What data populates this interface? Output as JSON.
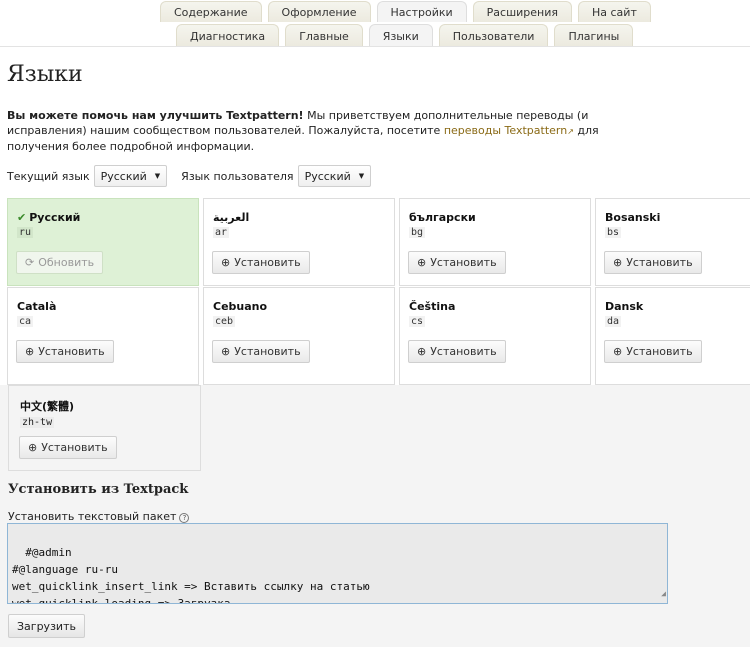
{
  "nav_primary": [
    "Содержание",
    "Оформление",
    "Настройки",
    "Расширения",
    "На сайт"
  ],
  "nav_secondary": [
    "Диагностика",
    "Главные",
    "Языки",
    "Пользователи",
    "Плагины"
  ],
  "page_title": "Языки",
  "intro": {
    "bold": "Вы можете помочь нам улучшить Textpattern!",
    "text1": " Мы приветствуем дополнительные переводы (и исправления) нашим сообществом пользователей. Пожалуйста, посетите ",
    "link": "переводы Textpattern",
    "text2": " для получения более подробной информации."
  },
  "lang_select": {
    "current_label": "Текущий язык",
    "current_value": "Русский",
    "user_label": "Язык пользователя",
    "user_value": "Русский"
  },
  "languages": [
    {
      "name": "Русский",
      "code": "ru",
      "button": "Обновить",
      "current": true
    },
    {
      "name": "العربية",
      "code": "ar",
      "button": "Установить"
    },
    {
      "name": "български",
      "code": "bg",
      "button": "Установить"
    },
    {
      "name": "Bosanski",
      "code": "bs",
      "button": "Установить"
    },
    {
      "name": "Català",
      "code": "ca",
      "button": "Установить"
    },
    {
      "name": "Cebuano",
      "code": "ceb",
      "button": "Установить"
    },
    {
      "name": "Čeština",
      "code": "cs",
      "button": "Установить"
    },
    {
      "name": "Dansk",
      "code": "da",
      "button": "Установить"
    }
  ],
  "last_language": {
    "name": "中文(繁體)",
    "code": "zh-tw",
    "button": "Установить"
  },
  "textpack": {
    "heading": "Установить из Textpack",
    "label": "Установить текстовый пакет",
    "content": "#@admin\n#@language ru-ru\nwet_quicklink_insert_link => Вставить ссылку на статью\nwet_quicklink_loading => Загрузка…",
    "submit": "Загрузить"
  }
}
